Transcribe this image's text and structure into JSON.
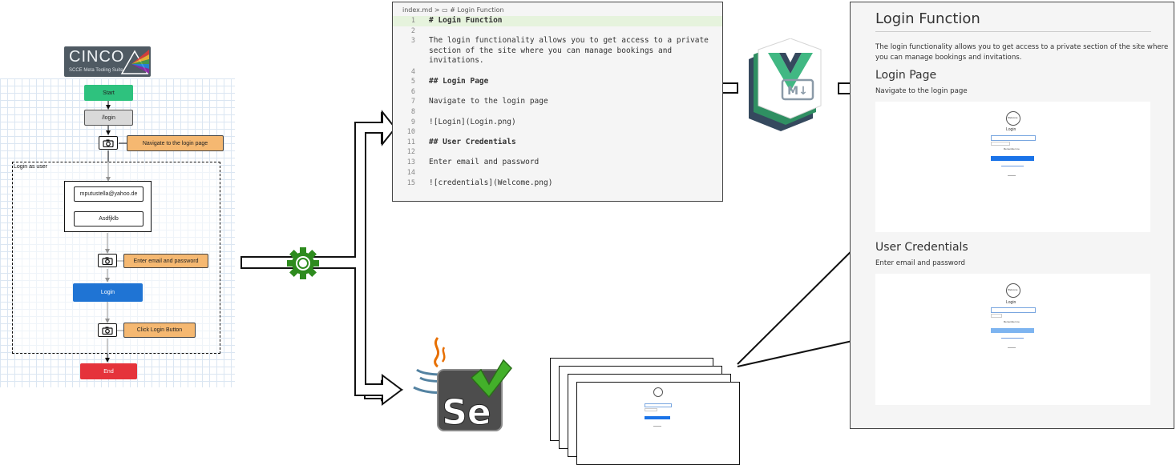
{
  "cinco": {
    "name": "CINCO",
    "subtitle": "SCCE Meta Tooling Suite"
  },
  "flow": {
    "start": "Start",
    "login_node": "/login",
    "note_navigate": "Navigate to the login page",
    "container_label": "Login as user",
    "email_value": "mputustella@yahoo.de",
    "password_value": "Asdfjklb",
    "note_enter": "Enter email and password",
    "login_button": "Login",
    "note_click": "Click Login Button",
    "end": "End"
  },
  "editor": {
    "breadcrumb": "index.md > ▭ # Login Function",
    "lines": [
      {
        "n": "1",
        "t": "# Login Function"
      },
      {
        "n": "2",
        "t": ""
      },
      {
        "n": "3",
        "t": "The login functionality allows you to get access to a private"
      },
      {
        "n": "",
        "t": "section of the site where you can manage bookings and"
      },
      {
        "n": "",
        "t": "invitations."
      },
      {
        "n": "4",
        "t": ""
      },
      {
        "n": "5",
        "t": "## Login Page"
      },
      {
        "n": "6",
        "t": ""
      },
      {
        "n": "7",
        "t": "Navigate to the login page"
      },
      {
        "n": "8",
        "t": ""
      },
      {
        "n": "9",
        "t": "![Login](Login.png)"
      },
      {
        "n": "10",
        "t": ""
      },
      {
        "n": "11",
        "t": "## User Credentials"
      },
      {
        "n": "12",
        "t": ""
      },
      {
        "n": "13",
        "t": "Enter email and password"
      },
      {
        "n": "14",
        "t": ""
      },
      {
        "n": "15",
        "t": "![credentials](Welcome.png)"
      }
    ]
  },
  "vuepress_badge": "M↓",
  "rendered": {
    "title": "Login Function",
    "intro_line1": "The login functionality allows you to get access to a private section of the site where",
    "intro_line2": "you can manage bookings and invitations.",
    "section1_title": "Login Page",
    "section1_text": "Navigate to the login page",
    "section2_title": "User Credentials",
    "section2_text": "Enter email and password",
    "shot_logo_text": "Welcome",
    "shot_heading": "Login",
    "shot_remember": "Remember me",
    "shot_button": "Login"
  },
  "selenium_badge": "Se",
  "colors": {
    "start": "#2ec27e",
    "login_node": "#d9d9d9",
    "login_button": "#1f74d4",
    "end": "#e5333b",
    "note": "#f5b871",
    "gear": "#2e8b1e",
    "vue_green": "#41b883",
    "vue_dark": "#35495e",
    "selenium_green": "#43b02a"
  }
}
